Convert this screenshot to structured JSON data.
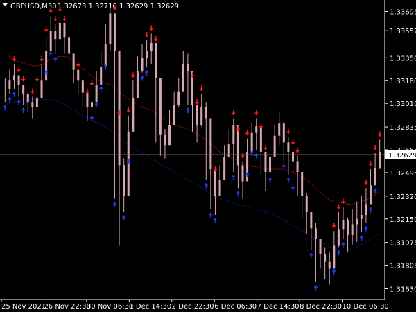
{
  "header": {
    "symbol_timeframe": "GBPUSD,M30",
    "ohlc": "1.32673 1.32710 1.32629 1.32629"
  },
  "price_axis": {
    "labels": [
      "1.33695",
      "1.33552",
      "1.33350",
      "1.33180",
      "1.33010",
      "1.32835",
      "1.32665",
      "1.32495",
      "1.32320",
      "1.32150",
      "1.31975",
      "1.31805",
      "1.31630"
    ],
    "current_price_label": "1.32629"
  },
  "time_axis": {
    "labels": [
      "25 Nov 2021",
      "26 Nov 22:30",
      "30 Nov 06:30",
      "1 Dec 14:30",
      "2 Dec 22:30",
      "6 Dec 06:30",
      "7 Dec 14:30",
      "8 Dec 22:30",
      "10 Dec 06:30"
    ]
  },
  "colors": {
    "background": "#000000",
    "candles": "#d8a7b1",
    "sell_arrow": "#ff1a1a",
    "buy_arrow": "#1e3cff",
    "red_line": "#8a1010",
    "blue_line": "#0b1a7a",
    "text": "#ffffff",
    "grid_line": "#808080"
  },
  "icons": {
    "menu_triangle": "triangle-down-icon",
    "sell_signal": "red-arrow-down-icon",
    "buy_signal": "blue-arrow-up-icon"
  },
  "chart_data": {
    "type": "candlestick",
    "symbol": "GBPUSD",
    "timeframe": "M30",
    "ylim": [
      1.3155,
      1.3378
    ],
    "current_price": 1.32629,
    "close_series": [
      1.3312,
      1.3318,
      1.3322,
      1.3315,
      1.3308,
      1.3302,
      1.3298,
      1.3305,
      1.3318,
      1.334,
      1.3355,
      1.3349,
      1.3361,
      1.335,
      1.3338,
      1.3326,
      1.3318,
      1.3309,
      1.3298,
      1.3302,
      1.3315,
      1.3328,
      1.3345,
      1.3368,
      1.334,
      1.3255,
      1.3232,
      1.328,
      1.3305,
      1.3325,
      1.3335,
      1.334,
      1.3346,
      1.332,
      1.3278,
      1.327,
      1.3285,
      1.33,
      1.331,
      1.333,
      1.3325,
      1.33,
      1.3285,
      1.3298,
      1.329,
      1.3252,
      1.3232,
      1.3244,
      1.3261,
      1.3271,
      1.3285,
      1.3255,
      1.3243,
      1.3265,
      1.3279,
      1.3284,
      1.3265,
      1.325,
      1.3261,
      1.3277,
      1.3286,
      1.3272,
      1.3265,
      1.3258,
      1.325,
      1.3232,
      1.322,
      1.3208,
      1.32,
      1.3189,
      1.3183,
      1.3178,
      1.3195,
      1.3207,
      1.3214,
      1.3203,
      1.3211,
      1.3215,
      1.3218,
      1.3226,
      1.324,
      1.3253,
      1.3265
    ],
    "high_series": [
      1.332,
      1.3326,
      1.333,
      1.3322,
      1.3315,
      1.331,
      1.3306,
      1.3315,
      1.333,
      1.3352,
      1.3366,
      1.336,
      1.3367,
      1.336,
      1.3348,
      1.3335,
      1.3326,
      1.3318,
      1.3306,
      1.3312,
      1.3325,
      1.334,
      1.336,
      1.3374,
      1.3368,
      1.329,
      1.326,
      1.3292,
      1.3318,
      1.3336,
      1.3345,
      1.3348,
      1.3353,
      1.3345,
      1.33,
      1.3282,
      1.3296,
      1.331,
      1.332,
      1.334,
      1.3338,
      1.3318,
      1.3298,
      1.3308,
      1.3302,
      1.3268,
      1.3248,
      1.3255,
      1.327,
      1.3282,
      1.329,
      1.3278,
      1.3258,
      1.3275,
      1.3287,
      1.329,
      1.328,
      1.3264,
      1.3272,
      1.3285,
      1.3294,
      1.3288,
      1.3276,
      1.3268,
      1.3262,
      1.3248,
      1.3234,
      1.322,
      1.3212,
      1.32,
      1.3194,
      1.319,
      1.3206,
      1.322,
      1.3224,
      1.3216,
      1.3222,
      1.3228,
      1.3232,
      1.3238,
      1.3252,
      1.3264,
      1.3274
    ],
    "low_series": [
      1.3302,
      1.3308,
      1.3312,
      1.3306,
      1.33,
      1.3294,
      1.329,
      1.3296,
      1.3306,
      1.3328,
      1.3342,
      1.3338,
      1.3348,
      1.3338,
      1.3326,
      1.3316,
      1.3308,
      1.3298,
      1.3288,
      1.3294,
      1.3304,
      1.3316,
      1.3332,
      1.334,
      1.323,
      1.3195,
      1.322,
      1.3262,
      1.3292,
      1.3312,
      1.3324,
      1.3328,
      1.333,
      1.3272,
      1.3262,
      1.326,
      1.327,
      1.3288,
      1.3298,
      1.3318,
      1.33,
      1.328,
      1.3272,
      1.3284,
      1.3244,
      1.3222,
      1.3218,
      1.3232,
      1.325,
      1.3262,
      1.325,
      1.3238,
      1.323,
      1.3252,
      1.3268,
      1.3266,
      1.3248,
      1.3236,
      1.3248,
      1.3264,
      1.327,
      1.3258,
      1.3248,
      1.3242,
      1.3232,
      1.3216,
      1.3204,
      1.3192,
      1.3168,
      1.3178,
      1.317,
      1.3166,
      1.318,
      1.3194,
      1.32,
      1.319,
      1.3196,
      1.3198,
      1.3205,
      1.3212,
      1.3226,
      1.324,
      1.3252
    ],
    "red_line_series": [
      1.3338,
      1.3336,
      1.3334,
      1.3332,
      1.3331,
      1.333,
      1.3329,
      1.3329,
      1.333,
      1.3332,
      1.3334,
      1.3335,
      1.3336,
      1.3336,
      1.3335,
      1.3333,
      1.333,
      1.3327,
      1.3324,
      1.3321,
      1.3319,
      1.3317,
      1.3316,
      1.3315,
      1.3313,
      1.331,
      1.3307,
      1.3304,
      1.3302,
      1.33,
      1.3298,
      1.3297,
      1.3296,
      1.3294,
      1.3291,
      1.3289,
      1.3287,
      1.3285,
      1.3284,
      1.3283,
      1.3282,
      1.328,
      1.3278,
      1.3276,
      1.3274,
      1.3271,
      1.3268,
      1.3265,
      1.3263,
      1.3261,
      1.326,
      1.3258,
      1.3256,
      1.3255,
      1.3254,
      1.3254,
      1.3253,
      1.3252,
      1.3252,
      1.3252,
      1.3252,
      1.3252,
      1.3251,
      1.325,
      1.3248,
      1.3246,
      1.3244,
      1.3241,
      1.3238,
      1.3235,
      1.3232,
      1.3229,
      1.3228,
      1.3227,
      1.3227,
      1.3226,
      1.3226,
      1.3227,
      1.3228,
      1.3229,
      1.3231,
      1.3233,
      1.3236
    ],
    "blue_line_series": [
      1.33,
      1.3301,
      1.3302,
      1.3303,
      1.3304,
      1.3304,
      1.3304,
      1.3304,
      1.3304,
      1.3304,
      1.3304,
      1.3303,
      1.3302,
      1.33,
      1.3298,
      1.3296,
      1.3294,
      1.3292,
      1.329,
      1.3288,
      1.3287,
      1.3285,
      1.3283,
      1.3281,
      1.3279,
      1.3276,
      1.3273,
      1.327,
      1.3268,
      1.3266,
      1.3264,
      1.3262,
      1.326,
      1.3258,
      1.3256,
      1.3254,
      1.3252,
      1.325,
      1.3248,
      1.3246,
      1.3244,
      1.3242,
      1.324,
      1.3238,
      1.3236,
      1.3234,
      1.3232,
      1.323,
      1.3229,
      1.3228,
      1.3227,
      1.3226,
      1.3225,
      1.3224,
      1.3223,
      1.3222,
      1.3221,
      1.322,
      1.3219,
      1.3218,
      1.3216,
      1.3214,
      1.3212,
      1.321,
      1.3208,
      1.3206,
      1.3204,
      1.3202,
      1.32,
      1.3198,
      1.3196,
      1.3194,
      1.3193,
      1.3192,
      1.3192,
      1.3192,
      1.3193,
      1.3194,
      1.3196,
      1.3198,
      1.32,
      1.3202,
      1.3204
    ],
    "sell_signal_indices": [
      2,
      3,
      4,
      6,
      7,
      8,
      9,
      10,
      11,
      12,
      13,
      16,
      18,
      19,
      24,
      25,
      27,
      28,
      31,
      32,
      33,
      41,
      42,
      43,
      46,
      50,
      51,
      52,
      53,
      55,
      56,
      57,
      62,
      63,
      64,
      72,
      73,
      74,
      79,
      80,
      81,
      82
    ],
    "buy_signal_indices": [
      0,
      1,
      2,
      3,
      4,
      9,
      10,
      11,
      19,
      20,
      21,
      22,
      24,
      26,
      27,
      30,
      31,
      40,
      44,
      45,
      46,
      50,
      51,
      53,
      54,
      55,
      58,
      61,
      62,
      63,
      67,
      68,
      72,
      73,
      74,
      78,
      79,
      80,
      81
    ]
  }
}
